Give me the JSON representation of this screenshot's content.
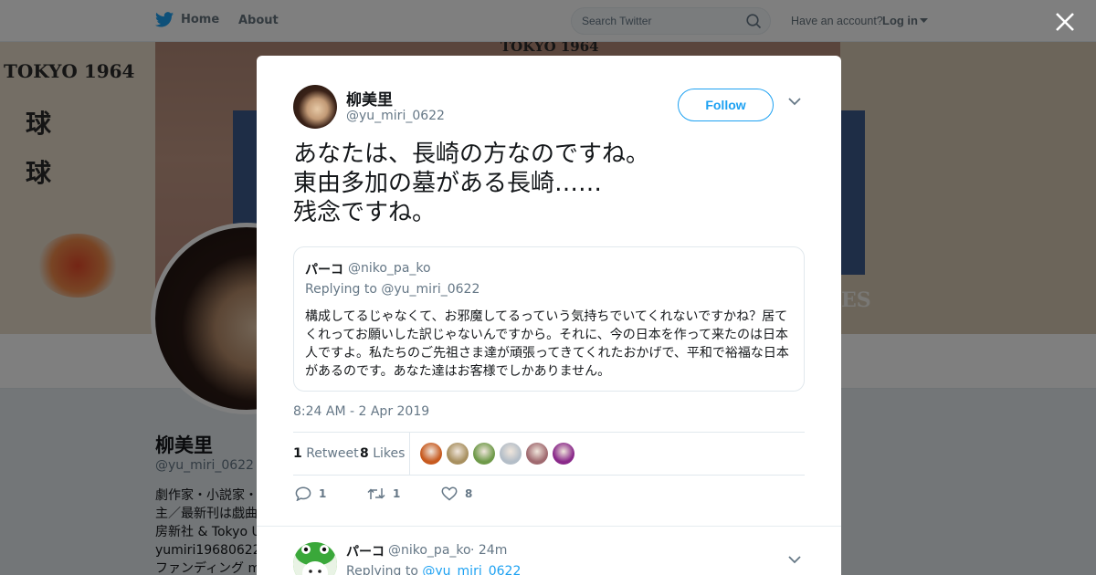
{
  "nav": {
    "home_label": "Home",
    "about_label": "About",
    "search_placeholder": "Search Twitter",
    "have_account": "Have an account?",
    "login_label": "Log in",
    "colors": {
      "twitter_blue": "#1da1f2"
    }
  },
  "background_profile": {
    "banner_texts": [
      "TOKYO 1964",
      "球",
      "球",
      "TOKYO 1964",
      "ES"
    ],
    "name": "柳美里",
    "handle": "@yu_miri_0622",
    "bio_lines": [
      "劇作家・小説家・",
      "主／最新刊は戯曲",
      "房新社 & Tokyo U",
      "yumiri19680622@",
      "ファンディング m"
    ]
  },
  "tweet": {
    "author_name": "柳美里",
    "author_handle": "@yu_miri_0622",
    "follow_label": "Follow",
    "text": "あなたは、長崎の方なのですね。\n東由多加の墓がある長崎……\n残念ですね。",
    "quote": {
      "name": "パーコ",
      "handle": "@niko_pa_ko",
      "replying_to_prefix": "Replying to",
      "replying_to_handle": "@yu_miri_0622",
      "text": "構成してるじゃなくて、お邪魔してるっていう気持ちでいてくれないですかね？居てくれってお願いした訳じゃないんですから。それに、今の日本を作って来たのは日本人ですよ。私たちのご先祖さま達が頑張ってきてくれたおかげで、平和で裕福な日本があるのです。あなた達はお客様でしかありません。"
    },
    "timestamp": "8:24 AM - 2 Apr 2019",
    "stats": {
      "retweet_count": "1",
      "retweet_label": "Retweet",
      "like_count": "8",
      "like_label": "Likes"
    },
    "likers": [
      {
        "name": "liker-1",
        "color": "#c75a1f"
      },
      {
        "name": "liker-2",
        "color": "#a89060"
      },
      {
        "name": "liker-3",
        "color": "#6f9a4a"
      },
      {
        "name": "liker-4",
        "color": "#b4bec8"
      },
      {
        "name": "liker-5",
        "color": "#a06a70"
      },
      {
        "name": "liker-6",
        "color": "#8a2a8a"
      }
    ],
    "actions": {
      "reply_count": "1",
      "retweet_count": "1",
      "like_count": "8"
    }
  },
  "reply": {
    "name": "パーコ",
    "handle": "@niko_pa_ko",
    "time": "· 24m",
    "replying_to_prefix": "Replying to",
    "replying_to_handle": "@yu_miri_0622"
  }
}
